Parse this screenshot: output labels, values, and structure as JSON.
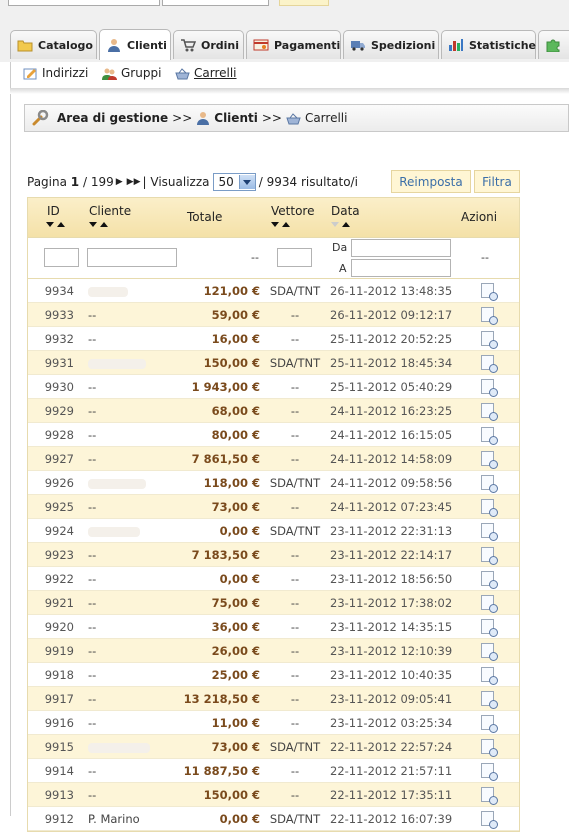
{
  "tabs": [
    {
      "label": "Catalogo",
      "icon": "folder-icon"
    },
    {
      "label": "Clienti",
      "icon": "user-icon",
      "active": true
    },
    {
      "label": "Ordini",
      "icon": "cart-icon"
    },
    {
      "label": "Pagamenti",
      "icon": "payment-icon"
    },
    {
      "label": "Spedizioni",
      "icon": "truck-icon"
    },
    {
      "label": "Statistiche",
      "icon": "bar-chart-icon"
    }
  ],
  "subnav": [
    {
      "label": "Indirizzi",
      "icon": "address-edit-icon"
    },
    {
      "label": "Gruppi",
      "icon": "group-icon"
    },
    {
      "label": "Carrelli",
      "icon": "basket-icon",
      "current": true
    }
  ],
  "breadcrumb": {
    "root": "Area di gestione",
    "sep": ">>",
    "section": "Clienti",
    "page": "Carrelli"
  },
  "pager": {
    "prefix": "Pagina",
    "page": "1",
    "total_pages": "/ 199",
    "sep": "|",
    "show_label": "Visualizza",
    "per_page": "50",
    "results": "/ 9934 risultato/i"
  },
  "buttons": {
    "reset": "Reimposta",
    "filter": "Filtra"
  },
  "columns": {
    "id": "ID",
    "cliente": "Cliente",
    "totale": "Totale",
    "vettore": "Vettore",
    "data": "Data",
    "azioni": "Azioni"
  },
  "filter": {
    "dash": "--",
    "da": "Da",
    "a": "A"
  },
  "rows": [
    {
      "id": "9934",
      "cliente": "",
      "blur": 40,
      "totale": "121,00 €",
      "vettore": "SDA/TNT",
      "data": "26-11-2012 13:48:35"
    },
    {
      "id": "9933",
      "cliente": "--",
      "totale": "59,00 €",
      "vettore": "--",
      "data": "26-11-2012 09:12:17"
    },
    {
      "id": "9932",
      "cliente": "--",
      "totale": "16,00 €",
      "vettore": "--",
      "data": "25-11-2012 20:52:25"
    },
    {
      "id": "9931",
      "cliente": "",
      "blur": 58,
      "totale": "150,00 €",
      "vettore": "SDA/TNT",
      "data": "25-11-2012 18:45:34"
    },
    {
      "id": "9930",
      "cliente": "--",
      "totale": "1 943,00 €",
      "vettore": "--",
      "data": "25-11-2012 05:40:29"
    },
    {
      "id": "9929",
      "cliente": "--",
      "totale": "68,00 €",
      "vettore": "--",
      "data": "24-11-2012 16:23:25"
    },
    {
      "id": "9928",
      "cliente": "--",
      "totale": "80,00 €",
      "vettore": "--",
      "data": "24-11-2012 16:15:05"
    },
    {
      "id": "9927",
      "cliente": "--",
      "totale": "7 861,50 €",
      "vettore": "--",
      "data": "24-11-2012 14:58:09"
    },
    {
      "id": "9926",
      "cliente": "",
      "blur": 58,
      "totale": "118,00 €",
      "vettore": "SDA/TNT",
      "data": "24-11-2012 09:58:56"
    },
    {
      "id": "9925",
      "cliente": "--",
      "totale": "73,00 €",
      "vettore": "--",
      "data": "24-11-2012 07:23:45"
    },
    {
      "id": "9924",
      "cliente": "",
      "blur": 52,
      "totale": "0,00 €",
      "vettore": "SDA/TNT",
      "data": "23-11-2012 22:31:13"
    },
    {
      "id": "9923",
      "cliente": "--",
      "totale": "7 183,50 €",
      "vettore": "--",
      "data": "23-11-2012 22:14:17"
    },
    {
      "id": "9922",
      "cliente": "--",
      "totale": "0,00 €",
      "vettore": "--",
      "data": "23-11-2012 18:56:50"
    },
    {
      "id": "9921",
      "cliente": "--",
      "totale": "75,00 €",
      "vettore": "--",
      "data": "23-11-2012 17:38:02"
    },
    {
      "id": "9920",
      "cliente": "--",
      "totale": "36,00 €",
      "vettore": "--",
      "data": "23-11-2012 14:35:15"
    },
    {
      "id": "9919",
      "cliente": "--",
      "totale": "26,00 €",
      "vettore": "--",
      "data": "23-11-2012 12:10:39"
    },
    {
      "id": "9918",
      "cliente": "--",
      "totale": "25,00 €",
      "vettore": "--",
      "data": "23-11-2012 10:40:35"
    },
    {
      "id": "9917",
      "cliente": "--",
      "totale": "13 218,50 €",
      "vettore": "--",
      "data": "23-11-2012 09:05:41"
    },
    {
      "id": "9916",
      "cliente": "--",
      "totale": "11,00 €",
      "vettore": "--",
      "data": "23-11-2012 03:25:34"
    },
    {
      "id": "9915",
      "cliente": "",
      "blur": 62,
      "totale": "73,00 €",
      "vettore": "SDA/TNT",
      "data": "22-11-2012 22:57:24"
    },
    {
      "id": "9914",
      "cliente": "--",
      "totale": "11 887,50 €",
      "vettore": "--",
      "data": "22-11-2012 21:57:11"
    },
    {
      "id": "9913",
      "cliente": "--",
      "totale": "150,00 €",
      "vettore": "--",
      "data": "22-11-2012 17:35:11"
    },
    {
      "id": "9912",
      "cliente": "P. Marino",
      "totale": "0,00 €",
      "vettore": "SDA/TNT",
      "data": "22-11-2012 16:07:39"
    }
  ]
}
